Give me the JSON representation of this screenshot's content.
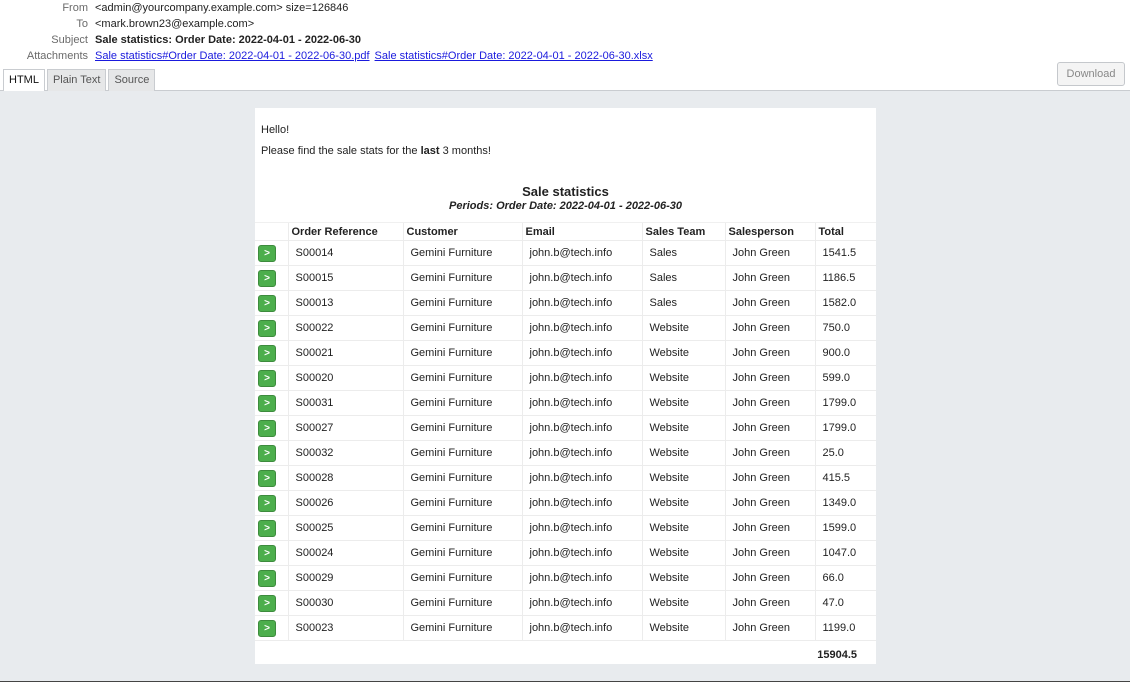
{
  "headers": {
    "from_label": "From",
    "from_value": "<admin@yourcompany.example.com> size=126846",
    "to_label": "To",
    "to_value": "<mark.brown23@example.com>",
    "subject_label": "Subject",
    "subject_value": "Sale statistics: Order Date: 2022-04-01 - 2022-06-30",
    "attachments_label": "Attachments",
    "attachments": [
      "Sale statistics#Order Date: 2022-04-01 - 2022-06-30.pdf",
      "Sale statistics#Order Date: 2022-04-01 - 2022-06-30.xlsx"
    ]
  },
  "tabs": [
    "HTML",
    "Plain Text",
    "Source"
  ],
  "active_tab": "HTML",
  "download_label": "Download",
  "body": {
    "greeting": "Hello!",
    "intro_pre": "Please find the sale stats for the ",
    "intro_bold": "last",
    "intro_post": " 3 months!",
    "report_title": "Sale statistics",
    "report_subtitle": "Periods: Order Date: 2022-04-01 - 2022-06-30",
    "columns": [
      "",
      "Order Reference",
      "Customer",
      "Email",
      "Sales Team",
      "Salesperson",
      "Total"
    ],
    "row_button_label": ">",
    "rows": [
      [
        "S00014",
        "Gemini Furniture",
        "john.b@tech.info",
        "Sales",
        "John Green",
        "1541.5"
      ],
      [
        "S00015",
        "Gemini Furniture",
        "john.b@tech.info",
        "Sales",
        "John Green",
        "1186.5"
      ],
      [
        "S00013",
        "Gemini Furniture",
        "john.b@tech.info",
        "Sales",
        "John Green",
        "1582.0"
      ],
      [
        "S00022",
        "Gemini Furniture",
        "john.b@tech.info",
        "Website",
        "John Green",
        "750.0"
      ],
      [
        "S00021",
        "Gemini Furniture",
        "john.b@tech.info",
        "Website",
        "John Green",
        "900.0"
      ],
      [
        "S00020",
        "Gemini Furniture",
        "john.b@tech.info",
        "Website",
        "John Green",
        "599.0"
      ],
      [
        "S00031",
        "Gemini Furniture",
        "john.b@tech.info",
        "Website",
        "John Green",
        "1799.0"
      ],
      [
        "S00027",
        "Gemini Furniture",
        "john.b@tech.info",
        "Website",
        "John Green",
        "1799.0"
      ],
      [
        "S00032",
        "Gemini Furniture",
        "john.b@tech.info",
        "Website",
        "John Green",
        "25.0"
      ],
      [
        "S00028",
        "Gemini Furniture",
        "john.b@tech.info",
        "Website",
        "John Green",
        "415.5"
      ],
      [
        "S00026",
        "Gemini Furniture",
        "john.b@tech.info",
        "Website",
        "John Green",
        "1349.0"
      ],
      [
        "S00025",
        "Gemini Furniture",
        "john.b@tech.info",
        "Website",
        "John Green",
        "1599.0"
      ],
      [
        "S00024",
        "Gemini Furniture",
        "john.b@tech.info",
        "Website",
        "John Green",
        "1047.0"
      ],
      [
        "S00029",
        "Gemini Furniture",
        "john.b@tech.info",
        "Website",
        "John Green",
        "66.0"
      ],
      [
        "S00030",
        "Gemini Furniture",
        "john.b@tech.info",
        "Website",
        "John Green",
        "47.0"
      ],
      [
        "S00023",
        "Gemini Furniture",
        "john.b@tech.info",
        "Website",
        "John Green",
        "1199.0"
      ]
    ],
    "grand_total": "15904.5"
  },
  "colors": {
    "go_button": "#4cae4c",
    "link": "#1a1add",
    "background": "#e8ebee"
  }
}
